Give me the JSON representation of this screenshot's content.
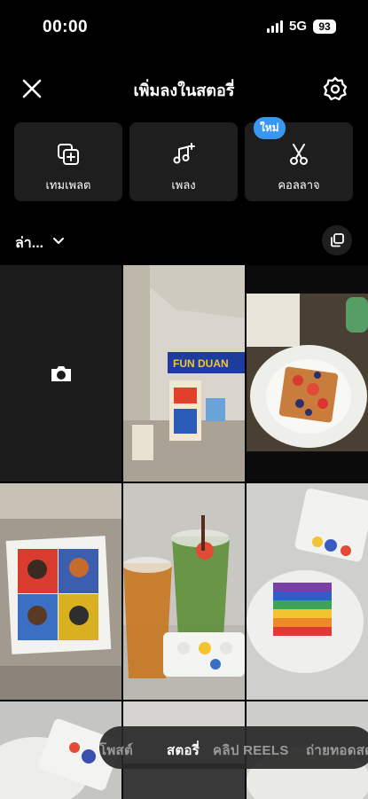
{
  "status": {
    "time": "00:00",
    "network": "5G",
    "battery": "93"
  },
  "header": {
    "title": "เพิ่มลงในสตอรี่"
  },
  "actions": [
    {
      "label": "เทมเพลต"
    },
    {
      "label": "เพลง"
    },
    {
      "label": "คอลลาจ"
    }
  ],
  "new_badge": "ใหม่",
  "album": {
    "label": "ล่า..."
  },
  "modes": [
    {
      "label": "โพสต์",
      "active": false
    },
    {
      "label": "สตอรี่",
      "active": true
    },
    {
      "label": "คลิป REELS",
      "active": false
    },
    {
      "label": "ถ่ายทอดสด",
      "active": false
    }
  ],
  "photo_sign": "FUN DUAN",
  "colors": {
    "badge": "#3897f0",
    "tile": "#1e1e1e",
    "accent_yellow": "#f4c430"
  }
}
